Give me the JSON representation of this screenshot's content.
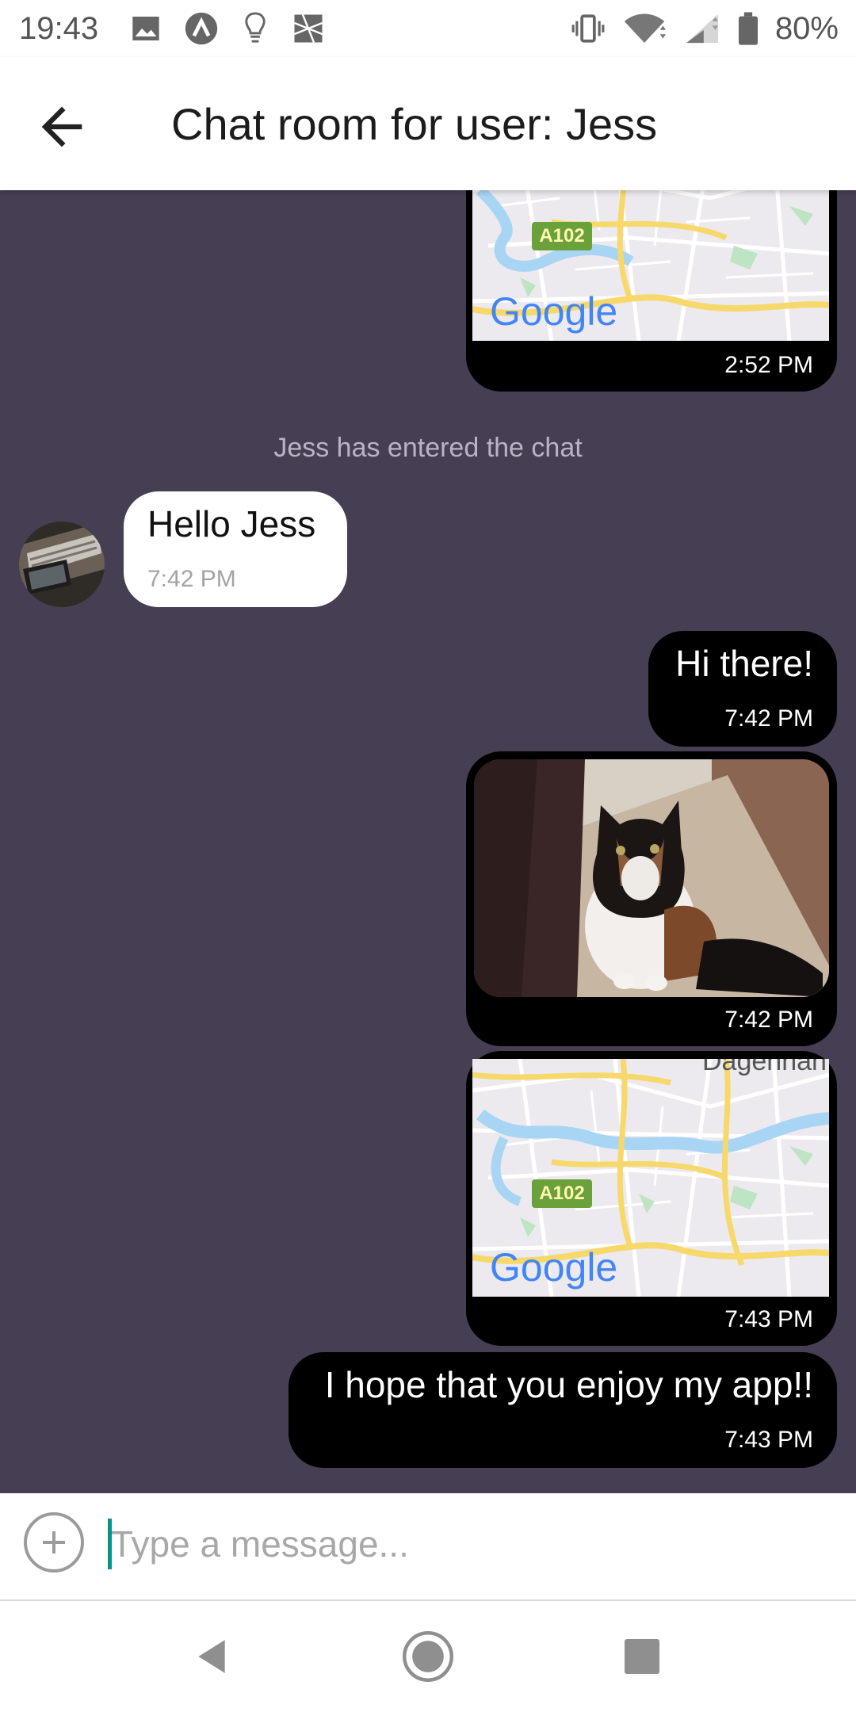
{
  "status_bar": {
    "time": "19:43",
    "battery": "80%",
    "icons": [
      "image-icon",
      "app-a-icon",
      "lightbulb-icon",
      "crossed-box-icon",
      "vibrate-icon",
      "wifi-icon",
      "signal-icon",
      "battery-icon"
    ]
  },
  "app_bar": {
    "title": "Chat room for user: Jess",
    "back_icon": "arrow-back-icon"
  },
  "chat": {
    "messages": [
      {
        "type": "location",
        "from": "me",
        "time": "2:52 PM",
        "map_labels": {
          "road": "A102",
          "logo": "Google"
        }
      },
      {
        "type": "system",
        "text": "Jess has entered the chat"
      },
      {
        "type": "text",
        "from": "Jess",
        "text": "Hello Jess",
        "time": "7:42 PM"
      },
      {
        "type": "text",
        "from": "me",
        "text": "Hi there!",
        "time": "7:42 PM"
      },
      {
        "type": "image",
        "from": "me",
        "time": "7:42 PM"
      },
      {
        "type": "location",
        "from": "me",
        "time": "7:43 PM",
        "map_labels": {
          "road": "A102",
          "logo": "Google",
          "place": "Dagenhan"
        }
      },
      {
        "type": "text",
        "from": "me",
        "text": "I hope that you enjoy my app!!",
        "time": "7:43 PM"
      }
    ]
  },
  "composer": {
    "placeholder": "Type a message...",
    "value": ""
  },
  "colors": {
    "chat_background": "#463f54",
    "outgoing_bubble": "#000000",
    "incoming_bubble": "#ffffff",
    "cursor": "#009688"
  }
}
